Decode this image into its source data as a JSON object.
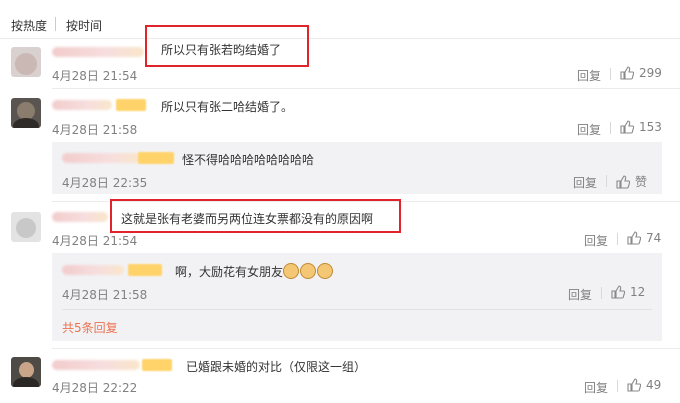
{
  "sort": {
    "hot": "按热度",
    "time": "按时间"
  },
  "comments": [
    {
      "text": "所以只有张若昀结婚了",
      "time": "4月28日 21:54",
      "reply": "回复",
      "likes": "299"
    },
    {
      "text": "所以只有张二哈结婚了。",
      "time": "4月28日 21:58",
      "reply": "回复",
      "likes": "153",
      "subreply": {
        "text": "怪不得哈哈哈哈哈哈哈哈",
        "time": "4月28日 22:35",
        "reply": "回复",
        "likes": "赞"
      }
    },
    {
      "text": "这就是张有老婆而另两位连女票都没有的原因啊",
      "time": "4月28日 21:54",
      "reply": "回复",
      "likes": "74",
      "subreply": {
        "text": "啊，大励花有女朋友",
        "time": "4月28日 21:58",
        "reply": "回复",
        "likes": "12"
      },
      "more": "共5条回复"
    },
    {
      "text": "已婚跟未婚的对比（仅限这一组）",
      "time": "4月28日 22:22",
      "reply": "回复",
      "likes": "49"
    }
  ],
  "icons": {
    "like": "thumbs-up-icon",
    "emoji": "cat-face-emoji"
  },
  "colors": {
    "highlight": "#e0242b",
    "link": "#eb7350",
    "muted": "#808080"
  }
}
